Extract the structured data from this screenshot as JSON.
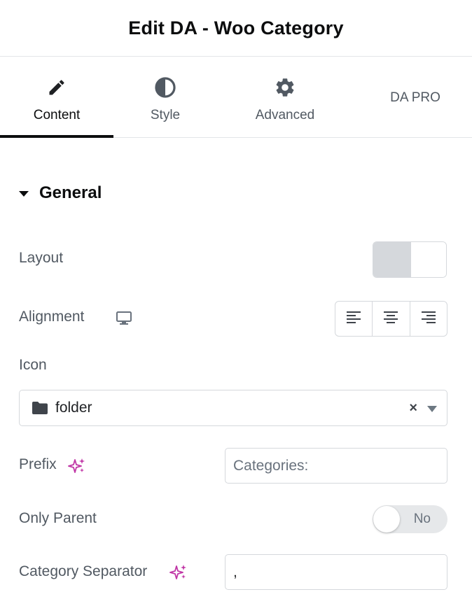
{
  "header": {
    "title": "Edit DA - Woo Category"
  },
  "tabs": [
    {
      "label": "Content",
      "icon": "pencil-icon",
      "active": true
    },
    {
      "label": "Style",
      "icon": "contrast-icon",
      "active": false
    },
    {
      "label": "Advanced",
      "icon": "gear-icon",
      "active": false
    },
    {
      "label": "DA PRO",
      "icon": "",
      "active": false
    }
  ],
  "section": {
    "title": "General",
    "expanded": true
  },
  "fields": {
    "layout": {
      "label": "Layout"
    },
    "alignment": {
      "label": "Alignment",
      "device_icon": "desktop-icon",
      "options": [
        "align-left-icon",
        "align-center-icon",
        "align-right-icon"
      ]
    },
    "icon": {
      "label": "Icon",
      "value": "folder",
      "icon": "folder-icon"
    },
    "prefix": {
      "label": "Prefix",
      "value": "",
      "placeholder": "Categories:"
    },
    "only_parent": {
      "label": "Only Parent",
      "toggle_text": "No",
      "value": false
    },
    "category_separator": {
      "label": "Category Separator",
      "value": ","
    }
  },
  "colors": {
    "ai_accent": "#c036a6",
    "active_tab_underline": "#0c0d0e",
    "border": "#d5d8dc"
  }
}
